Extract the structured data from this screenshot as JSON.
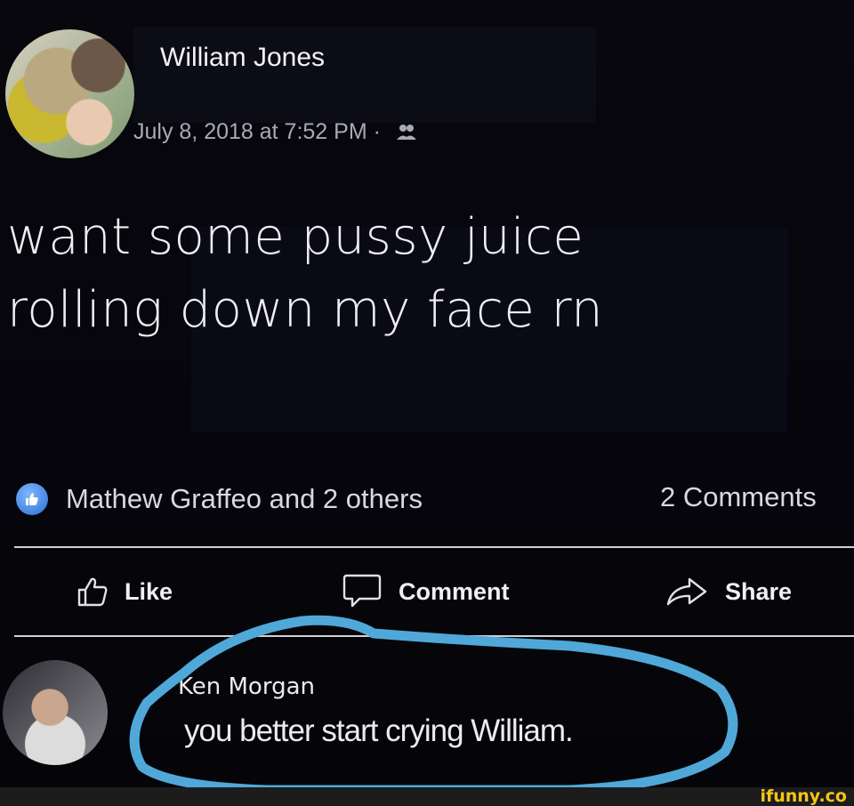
{
  "post": {
    "author": "William Jones",
    "timestamp": "July 8, 2018 at 7:52 PM ·",
    "privacy_icon": "friends-icon",
    "text_line1": "want some pussy juice",
    "text_line2": "rolling down my face rn"
  },
  "reactions": {
    "icon": "like-icon",
    "text": "Mathew Graffeo and 2 others",
    "comments_count": "2 Comments"
  },
  "actions": {
    "like": "Like",
    "comment": "Comment",
    "share": "Share"
  },
  "comment": {
    "author": "Ken Morgan",
    "text": "you better start crying William."
  },
  "watermark": "ifunny.co",
  "colors": {
    "background": "#05050a",
    "like_blue": "#2b6fd6",
    "circle_annotation": "#4fa8d8",
    "watermark": "#f5c518"
  }
}
